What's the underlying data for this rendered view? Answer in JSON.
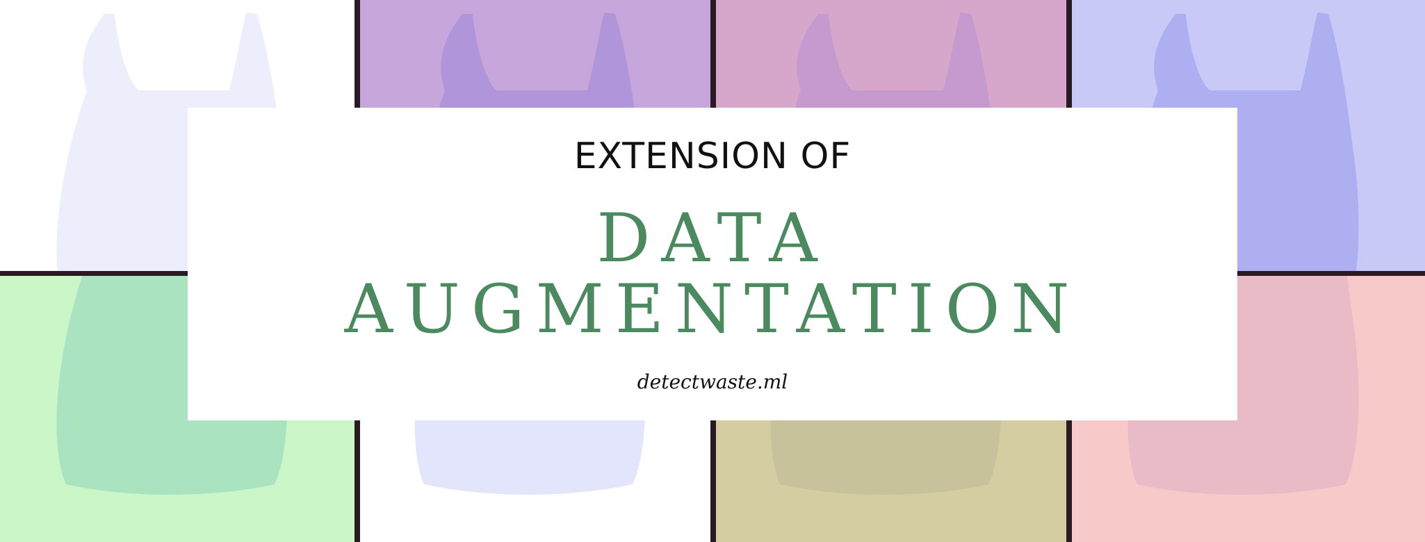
{
  "banner": {
    "kicker": "EXTENSION OF",
    "title_line1": "DATA",
    "title_line2": "AUGMENTATION",
    "site": "detectwaste.ml",
    "title_color": "#4b8a5e"
  },
  "tiles": [
    {
      "name": "tile-white-top",
      "bg": "#ffffff",
      "bag": "#e6e8fb"
    },
    {
      "name": "tile-purple",
      "bg": "#c6a6db",
      "bag": "#a98fdb"
    },
    {
      "name": "tile-pink",
      "bg": "#d6a6cb",
      "bag": "#c096cf"
    },
    {
      "name": "tile-lavender",
      "bg": "#c9c9f7",
      "bag": "#a3a6ef"
    },
    {
      "name": "tile-green",
      "bg": "#caf6c8",
      "bag": "#9fdcbc"
    },
    {
      "name": "tile-white-bottom",
      "bg": "#ffffff",
      "bag": "#d8dcfa"
    },
    {
      "name": "tile-khaki",
      "bg": "#d4cda2",
      "bag": "#c3bd99"
    },
    {
      "name": "tile-salmon",
      "bg": "#f8c9c9",
      "bag": "#e4b5c6"
    }
  ]
}
